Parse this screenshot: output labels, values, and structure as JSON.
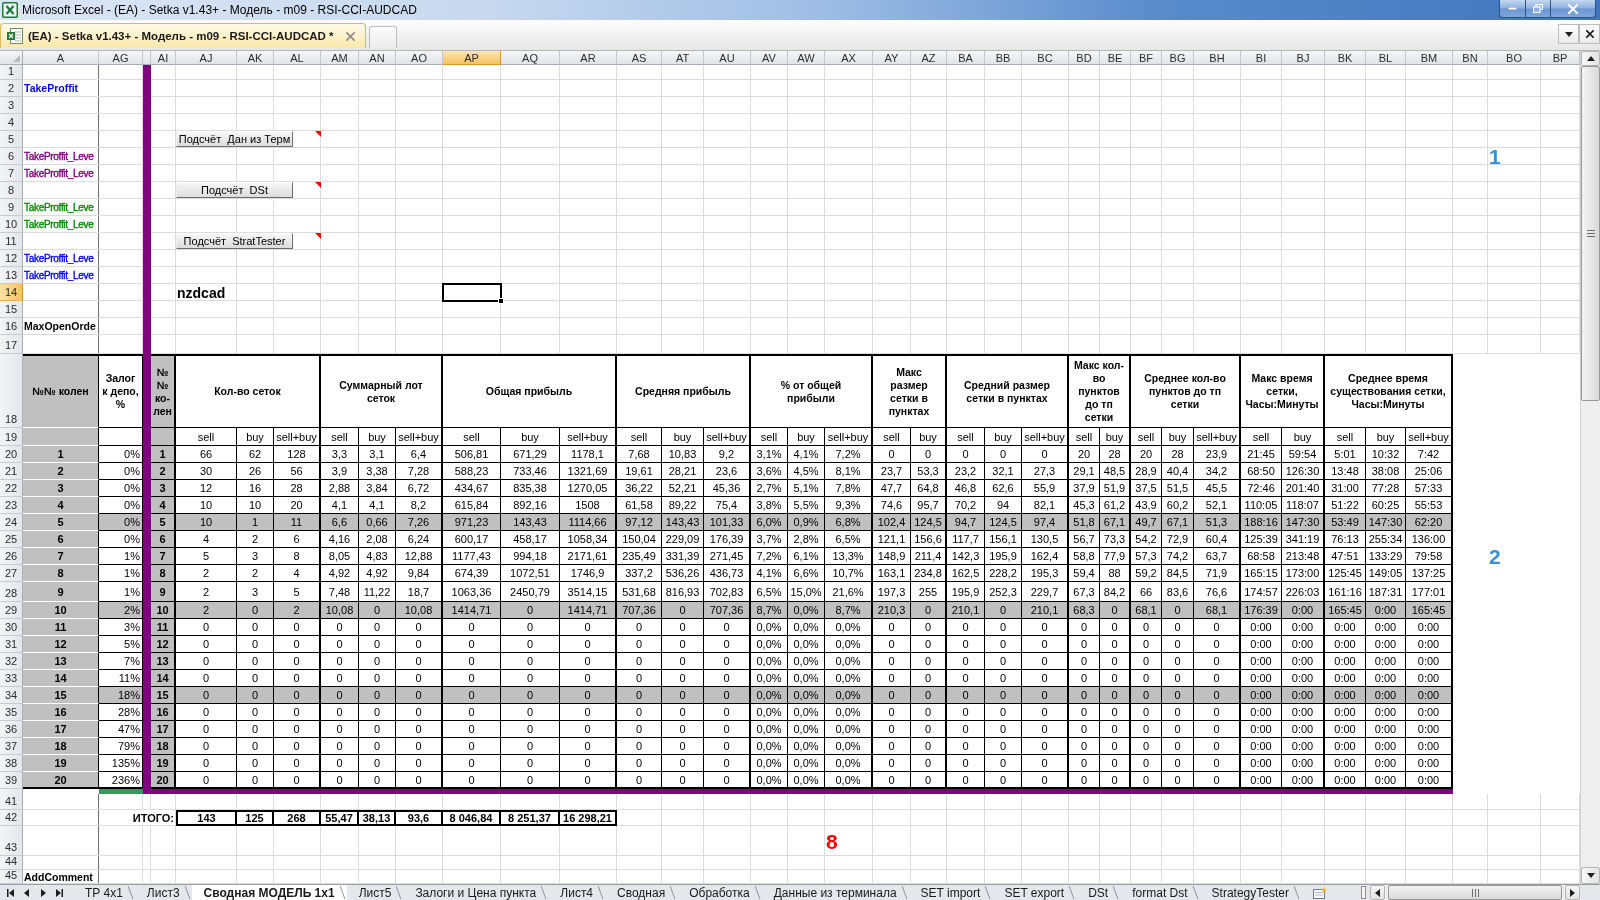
{
  "window": {
    "title": "Microsoft Excel - (EA) - Setka v1.43+ - Модель - m09 - RSI-CCI-AUDCAD"
  },
  "document_tabs": [
    {
      "label": "(EA) - Setka v1.43+ - Модель - m09 - RSI-CCI-AUDCAD *",
      "selected": true
    }
  ],
  "sheet": {
    "columns": [
      {
        "label": "A",
        "selected": false
      },
      {
        "label": "AG",
        "selected": false
      },
      {
        "label": "AI",
        "selected": false
      },
      {
        "label": "AJ",
        "selected": false
      },
      {
        "label": "AK",
        "selected": false
      },
      {
        "label": "AL",
        "selected": false
      },
      {
        "label": "AM",
        "selected": false
      },
      {
        "label": "AN",
        "selected": false
      },
      {
        "label": "AO",
        "selected": false
      },
      {
        "label": "AP",
        "selected": true
      },
      {
        "label": "AQ",
        "selected": false
      },
      {
        "label": "AR",
        "selected": false
      },
      {
        "label": "AS",
        "selected": false
      },
      {
        "label": "AT",
        "selected": false
      },
      {
        "label": "AU",
        "selected": false
      },
      {
        "label": "AV",
        "selected": false
      },
      {
        "label": "AW",
        "selected": false
      },
      {
        "label": "AX",
        "selected": false
      },
      {
        "label": "AY",
        "selected": false
      },
      {
        "label": "AZ",
        "selected": false
      },
      {
        "label": "BA",
        "selected": false
      },
      {
        "label": "BB",
        "selected": false
      },
      {
        "label": "BC",
        "selected": false
      },
      {
        "label": "BD",
        "selected": false
      },
      {
        "label": "BE",
        "selected": false
      },
      {
        "label": "BF",
        "selected": false
      },
      {
        "label": "BG",
        "selected": false
      },
      {
        "label": "BH",
        "selected": false
      },
      {
        "label": "BI",
        "selected": false
      },
      {
        "label": "BJ",
        "selected": false
      },
      {
        "label": "BK",
        "selected": false
      },
      {
        "label": "BL",
        "selected": false
      },
      {
        "label": "BM",
        "selected": false
      },
      {
        "label": "BN",
        "selected": false
      },
      {
        "label": "BO",
        "selected": false
      },
      {
        "label": "BP",
        "selected": false
      }
    ],
    "top_rows": [
      {
        "number": "1",
        "selected": false
      },
      {
        "number": "2",
        "selected": false,
        "column_a": {
          "kind": "heading",
          "text": "TakeProffit",
          "color": "#0000ff"
        }
      },
      {
        "number": "3",
        "selected": false
      },
      {
        "number": "4",
        "selected": false
      },
      {
        "number": "5",
        "selected": false,
        "button": {
          "label": "Подсчёт  Дан из Терм",
          "comment": true
        }
      },
      {
        "number": "6",
        "selected": false,
        "column_a": {
          "kind": "label",
          "text": "TakeProffit_Leve",
          "color": "#800080"
        },
        "column_bo": {
          "kind": "marker",
          "text": "1",
          "color": "#3a8fd9"
        }
      },
      {
        "number": "7",
        "selected": false,
        "column_a": {
          "kind": "label",
          "text": "TakeProffit_Leve",
          "color": "#800080"
        }
      },
      {
        "number": "8",
        "selected": false,
        "button": {
          "label": "Подсчёт  DSt",
          "comment": true
        }
      },
      {
        "number": "9",
        "selected": false,
        "column_a": {
          "kind": "label",
          "text": "TakeProffit_Leve",
          "color": "#008a00"
        }
      },
      {
        "number": "10",
        "selected": false,
        "column_a": {
          "kind": "label",
          "text": "TakeProffit_Leve",
          "color": "#008a00"
        }
      },
      {
        "number": "11",
        "selected": false,
        "button": {
          "label": "Подсчёт  StratTester",
          "comment": true
        }
      },
      {
        "number": "12",
        "selected": false,
        "column_a": {
          "kind": "label",
          "text": "TakeProffit_Leve",
          "color": "#0000ff"
        }
      },
      {
        "number": "13",
        "selected": false,
        "column_a": {
          "kind": "label",
          "text": "TakeProffit_Leve",
          "color": "#0000ff"
        }
      },
      {
        "number": "14",
        "selected": true,
        "column_aj": {
          "kind": "ticker",
          "text": "nzdcad"
        },
        "column_ap": {
          "selected": true
        }
      },
      {
        "number": "15",
        "selected": false
      },
      {
        "number": "16",
        "selected": false,
        "column_a": {
          "kind": "heading",
          "text": "MaxOpenOrde"
        }
      },
      {
        "number": "17",
        "selected": false
      }
    ],
    "table": {
      "header_row": {
        "number": "18",
        "selected": false
      },
      "subheader_row": {
        "number": "19",
        "selected": false
      },
      "columns": {
        "knee": "№№ колен",
        "deposit": "Залог к депо, %",
        "knee_repeat": "№ № ко-лен"
      },
      "groups": [
        {
          "title": "Кол-во сеток",
          "columns": [
            "sell",
            "buy",
            "sell+buy"
          ]
        },
        {
          "title": "Суммарный лот сеток",
          "columns": [
            "sell",
            "buy",
            "sell+buy"
          ]
        },
        {
          "title": "Общая прибыль",
          "columns": [
            "sell",
            "buy",
            "sell+buy"
          ]
        },
        {
          "title": "Средняя прибыль",
          "columns": [
            "sell",
            "buy",
            "sell+buy"
          ]
        },
        {
          "title": "% от общей прибыли",
          "columns": [
            "sell",
            "buy",
            "sell+buy"
          ]
        },
        {
          "title": "Макс размер сетки в пунктах",
          "columns": [
            "sell",
            "buy"
          ]
        },
        {
          "title": "Средний размер сетки в пунктах",
          "columns": [
            "sell",
            "buy",
            "sell+buy"
          ]
        },
        {
          "title": "Макс кол-во пунктов до тп сетки",
          "columns": [
            "sell",
            "buy"
          ]
        },
        {
          "title": "Среднее кол-во пунктов до тп сетки",
          "columns": [
            "sell",
            "buy",
            "sell+buy"
          ]
        },
        {
          "title": "Макс время сетки, Часы:Минуты",
          "columns": [
            "sell",
            "buy"
          ]
        },
        {
          "title": "Среднее время существования сетки, Часы:Минуты",
          "columns": [
            "sell",
            "buy",
            "sell+buy"
          ]
        }
      ],
      "rows": [
        {
          "number": "20",
          "selected": false,
          "knee": "1",
          "deposit": "0%",
          "knee_repeat": "1",
          "highlighted": false,
          "values": [
            "66",
            "62",
            "128",
            "3,3",
            "3,1",
            "6,4",
            "506,81",
            "671,29",
            "1178,1",
            "7,68",
            "10,83",
            "9,2",
            "3,1%",
            "4,1%",
            "7,2%",
            "0",
            "0",
            "0",
            "0",
            "0",
            "20",
            "28",
            "20",
            "28",
            "23,9",
            "21:45",
            "59:54",
            "5:01",
            "10:32",
            "7:42"
          ]
        },
        {
          "number": "21",
          "selected": false,
          "knee": "2",
          "deposit": "0%",
          "knee_repeat": "2",
          "highlighted": false,
          "values": [
            "30",
            "26",
            "56",
            "3,9",
            "3,38",
            "7,28",
            "588,23",
            "733,46",
            "1321,69",
            "19,61",
            "28,21",
            "23,6",
            "3,6%",
            "4,5%",
            "8,1%",
            "23,7",
            "53,3",
            "23,2",
            "32,1",
            "27,3",
            "29,1",
            "48,5",
            "28,9",
            "40,4",
            "34,2",
            "68:50",
            "126:30",
            "13:48",
            "38:08",
            "25:06"
          ]
        },
        {
          "number": "22",
          "selected": false,
          "knee": "3",
          "deposit": "0%",
          "knee_repeat": "3",
          "highlighted": false,
          "values": [
            "12",
            "16",
            "28",
            "2,88",
            "3,84",
            "6,72",
            "434,67",
            "835,38",
            "1270,05",
            "36,22",
            "52,21",
            "45,36",
            "2,7%",
            "5,1%",
            "7,8%",
            "47,7",
            "64,8",
            "46,8",
            "62,6",
            "55,9",
            "37,9",
            "51,9",
            "37,5",
            "51,5",
            "45,5",
            "72:46",
            "201:40",
            "31:00",
            "77:28",
            "57:33"
          ]
        },
        {
          "number": "23",
          "selected": false,
          "knee": "4",
          "deposit": "0%",
          "knee_repeat": "4",
          "highlighted": false,
          "values": [
            "10",
            "10",
            "20",
            "4,1",
            "4,1",
            "8,2",
            "615,84",
            "892,16",
            "1508",
            "61,58",
            "89,22",
            "75,4",
            "3,8%",
            "5,5%",
            "9,3%",
            "74,6",
            "95,7",
            "70,2",
            "94",
            "82,1",
            "45,3",
            "61,2",
            "43,9",
            "60,2",
            "52,1",
            "110:05",
            "118:07",
            "51:22",
            "60:25",
            "55:53"
          ]
        },
        {
          "number": "24",
          "selected": false,
          "knee": "5",
          "deposit": "0%",
          "knee_repeat": "5",
          "highlighted": true,
          "values": [
            "10",
            "1",
            "11",
            "6,6",
            "0,66",
            "7,26",
            "971,23",
            "143,43",
            "1114,66",
            "97,12",
            "143,43",
            "101,33",
            "6,0%",
            "0,9%",
            "6,8%",
            "102,4",
            "124,5",
            "94,7",
            "124,5",
            "97,4",
            "51,8",
            "67,1",
            "49,7",
            "67,1",
            "51,3",
            "188:16",
            "147:30",
            "53:49",
            "147:30",
            "62:20"
          ]
        },
        {
          "number": "25",
          "selected": false,
          "knee": "6",
          "deposit": "0%",
          "knee_repeat": "6",
          "highlighted": false,
          "values": [
            "4",
            "2",
            "6",
            "4,16",
            "2,08",
            "6,24",
            "600,17",
            "458,17",
            "1058,34",
            "150,04",
            "229,09",
            "176,39",
            "3,7%",
            "2,8%",
            "6,5%",
            "121,1",
            "156,6",
            "117,7",
            "156,1",
            "130,5",
            "56,7",
            "73,3",
            "54,2",
            "72,9",
            "60,4",
            "125:39",
            "341:19",
            "76:13",
            "255:34",
            "136:00"
          ]
        },
        {
          "number": "26",
          "selected": false,
          "knee": "7",
          "deposit": "1%",
          "knee_repeat": "7",
          "highlighted": false,
          "column_bo": {
            "kind": "marker",
            "text": "2",
            "color": "#3a8fd9"
          },
          "values": [
            "5",
            "3",
            "8",
            "8,05",
            "4,83",
            "12,88",
            "1177,43",
            "994,18",
            "2171,61",
            "235,49",
            "331,39",
            "271,45",
            "7,2%",
            "6,1%",
            "13,3%",
            "148,9",
            "211,4",
            "142,3",
            "195,9",
            "162,4",
            "58,8",
            "77,9",
            "57,3",
            "74,2",
            "63,7",
            "68:58",
            "213:48",
            "47:51",
            "133:29",
            "79:58"
          ]
        },
        {
          "number": "27",
          "selected": false,
          "knee": "8",
          "deposit": "1%",
          "knee_repeat": "8",
          "highlighted": false,
          "values": [
            "2",
            "2",
            "4",
            "4,92",
            "4,92",
            "9,84",
            "674,39",
            "1072,51",
            "1746,9",
            "337,2",
            "536,26",
            "436,73",
            "4,1%",
            "6,6%",
            "10,7%",
            "163,1",
            "234,8",
            "162,5",
            "228,2",
            "195,3",
            "59,4",
            "88",
            "59,2",
            "84,5",
            "71,9",
            "165:15",
            "173:00",
            "125:45",
            "149:05",
            "137:25"
          ]
        },
        {
          "number": "28",
          "selected": false,
          "knee": "9",
          "deposit": "1%",
          "knee_repeat": "9",
          "highlighted": false,
          "values": [
            "2",
            "3",
            "5",
            "7,48",
            "11,22",
            "18,7",
            "1063,36",
            "2450,79",
            "3514,15",
            "531,68",
            "816,93",
            "702,83",
            "6,5%",
            "15,0%",
            "21,6%",
            "197,3",
            "255",
            "195,9",
            "252,3",
            "229,7",
            "67,3",
            "84,2",
            "66",
            "83,6",
            "76,6",
            "174:57",
            "226:03",
            "161:16",
            "187:31",
            "177:01"
          ]
        },
        {
          "number": "29",
          "selected": false,
          "knee": "10",
          "deposit": "2%",
          "knee_repeat": "10",
          "highlighted": true,
          "values": [
            "2",
            "0",
            "2",
            "10,08",
            "0",
            "10,08",
            "1414,71",
            "0",
            "1414,71",
            "707,36",
            "0",
            "707,36",
            "8,7%",
            "0,0%",
            "8,7%",
            "210,3",
            "0",
            "210,1",
            "0",
            "210,1",
            "68,3",
            "0",
            "68,1",
            "0",
            "68,1",
            "176:39",
            "0:00",
            "165:45",
            "0:00",
            "165:45"
          ]
        },
        {
          "number": "30",
          "selected": false,
          "knee": "11",
          "deposit": "3%",
          "knee_repeat": "11",
          "highlighted": false,
          "values": [
            "0",
            "0",
            "0",
            "0",
            "0",
            "0",
            "0",
            "0",
            "0",
            "0",
            "0",
            "0",
            "0,0%",
            "0,0%",
            "0,0%",
            "0",
            "0",
            "0",
            "0",
            "0",
            "0",
            "0",
            "0",
            "0",
            "0",
            "0:00",
            "0:00",
            "0:00",
            "0:00",
            "0:00"
          ]
        },
        {
          "number": "31",
          "selected": false,
          "knee": "12",
          "deposit": "5%",
          "knee_repeat": "12",
          "highlighted": false,
          "values": [
            "0",
            "0",
            "0",
            "0",
            "0",
            "0",
            "0",
            "0",
            "0",
            "0",
            "0",
            "0",
            "0,0%",
            "0,0%",
            "0,0%",
            "0",
            "0",
            "0",
            "0",
            "0",
            "0",
            "0",
            "0",
            "0",
            "0",
            "0:00",
            "0:00",
            "0:00",
            "0:00",
            "0:00"
          ]
        },
        {
          "number": "32",
          "selected": false,
          "knee": "13",
          "deposit": "7%",
          "knee_repeat": "13",
          "highlighted": false,
          "values": [
            "0",
            "0",
            "0",
            "0",
            "0",
            "0",
            "0",
            "0",
            "0",
            "0",
            "0",
            "0",
            "0,0%",
            "0,0%",
            "0,0%",
            "0",
            "0",
            "0",
            "0",
            "0",
            "0",
            "0",
            "0",
            "0",
            "0",
            "0:00",
            "0:00",
            "0:00",
            "0:00",
            "0:00"
          ]
        },
        {
          "number": "33",
          "selected": false,
          "knee": "14",
          "deposit": "11%",
          "knee_repeat": "14",
          "highlighted": false,
          "values": [
            "0",
            "0",
            "0",
            "0",
            "0",
            "0",
            "0",
            "0",
            "0",
            "0",
            "0",
            "0",
            "0,0%",
            "0,0%",
            "0,0%",
            "0",
            "0",
            "0",
            "0",
            "0",
            "0",
            "0",
            "0",
            "0",
            "0",
            "0:00",
            "0:00",
            "0:00",
            "0:00",
            "0:00"
          ]
        },
        {
          "number": "34",
          "selected": false,
          "knee": "15",
          "deposit": "18%",
          "knee_repeat": "15",
          "highlighted": true,
          "values": [
            "0",
            "0",
            "0",
            "0",
            "0",
            "0",
            "0",
            "0",
            "0",
            "0",
            "0",
            "0",
            "0,0%",
            "0,0%",
            "0,0%",
            "0",
            "0",
            "0",
            "0",
            "0",
            "0",
            "0",
            "0",
            "0",
            "0",
            "0:00",
            "0:00",
            "0:00",
            "0:00",
            "0:00"
          ]
        },
        {
          "number": "35",
          "selected": false,
          "knee": "16",
          "deposit": "28%",
          "knee_repeat": "16",
          "highlighted": false,
          "values": [
            "0",
            "0",
            "0",
            "0",
            "0",
            "0",
            "0",
            "0",
            "0",
            "0",
            "0",
            "0",
            "0,0%",
            "0,0%",
            "0,0%",
            "0",
            "0",
            "0",
            "0",
            "0",
            "0",
            "0",
            "0",
            "0",
            "0",
            "0:00",
            "0:00",
            "0:00",
            "0:00",
            "0:00"
          ]
        },
        {
          "number": "36",
          "selected": false,
          "knee": "17",
          "deposit": "47%",
          "knee_repeat": "17",
          "highlighted": false,
          "values": [
            "0",
            "0",
            "0",
            "0",
            "0",
            "0",
            "0",
            "0",
            "0",
            "0",
            "0",
            "0",
            "0,0%",
            "0,0%",
            "0,0%",
            "0",
            "0",
            "0",
            "0",
            "0",
            "0",
            "0",
            "0",
            "0",
            "0",
            "0:00",
            "0:00",
            "0:00",
            "0:00",
            "0:00"
          ]
        },
        {
          "number": "37",
          "selected": false,
          "knee": "18",
          "deposit": "79%",
          "knee_repeat": "18",
          "highlighted": false,
          "values": [
            "0",
            "0",
            "0",
            "0",
            "0",
            "0",
            "0",
            "0",
            "0",
            "0",
            "0",
            "0",
            "0,0%",
            "0,0%",
            "0,0%",
            "0",
            "0",
            "0",
            "0",
            "0",
            "0",
            "0",
            "0",
            "0",
            "0",
            "0:00",
            "0:00",
            "0:00",
            "0:00",
            "0:00"
          ]
        },
        {
          "number": "38",
          "selected": false,
          "knee": "19",
          "deposit": "135%",
          "knee_repeat": "19",
          "highlighted": false,
          "values": [
            "0",
            "0",
            "0",
            "0",
            "0",
            "0",
            "0",
            "0",
            "0",
            "0",
            "0",
            "0",
            "0,0%",
            "0,0%",
            "0,0%",
            "0",
            "0",
            "0",
            "0",
            "0",
            "0",
            "0",
            "0",
            "0",
            "0",
            "0:00",
            "0:00",
            "0:00",
            "0:00",
            "0:00"
          ]
        },
        {
          "number": "39",
          "selected": false,
          "knee": "20",
          "deposit": "236%",
          "knee_repeat": "20",
          "highlighted": false,
          "values": [
            "0",
            "0",
            "0",
            "0",
            "0",
            "0",
            "0",
            "0",
            "0",
            "0",
            "0",
            "0",
            "0,0%",
            "0,0%",
            "0,0%",
            "0",
            "0",
            "0",
            "0",
            "0",
            "0",
            "0",
            "0",
            "0",
            "0",
            "0:00",
            "0:00",
            "0:00",
            "0:00",
            "0:00"
          ]
        }
      ]
    },
    "bottom_rows": [
      {
        "number": "41",
        "selected": false
      },
      {
        "number": "42",
        "selected": false,
        "totals": {
          "label": "ИТОГО:",
          "values": [
            "143",
            "125",
            "268",
            "55,47",
            "38,13",
            "93,6",
            "8 046,84",
            "8 251,37",
            "16 298,21"
          ]
        }
      },
      {
        "number": "43",
        "selected": false,
        "column_ax": {
          "kind": "marker",
          "text": "8",
          "color": "#ff0000"
        }
      },
      {
        "number": "44",
        "selected": false
      },
      {
        "number": "45",
        "selected": false,
        "column_a": {
          "kind": "heading",
          "text": "AddComment"
        }
      }
    ]
  },
  "sheet_tabs": [
    {
      "label": "TP 4x1",
      "selected": false
    },
    {
      "label": "Лист3",
      "selected": false
    },
    {
      "label": "Сводная МОДЕЛЬ 1x1",
      "selected": true
    },
    {
      "label": "Лист5",
      "selected": false
    },
    {
      "label": "Залоги и Цена пункта",
      "selected": false
    },
    {
      "label": "Лист4",
      "selected": false
    },
    {
      "label": "Сводная",
      "selected": false
    },
    {
      "label": "Обработка",
      "selected": false
    },
    {
      "label": "Данные из терминала",
      "selected": false
    },
    {
      "label": "SET import",
      "selected": false
    },
    {
      "label": "SET export",
      "selected": false
    },
    {
      "label": "DSt",
      "selected": false
    },
    {
      "label": "format Dst",
      "selected": false
    },
    {
      "label": "StrategyTester",
      "selected": false
    }
  ]
}
